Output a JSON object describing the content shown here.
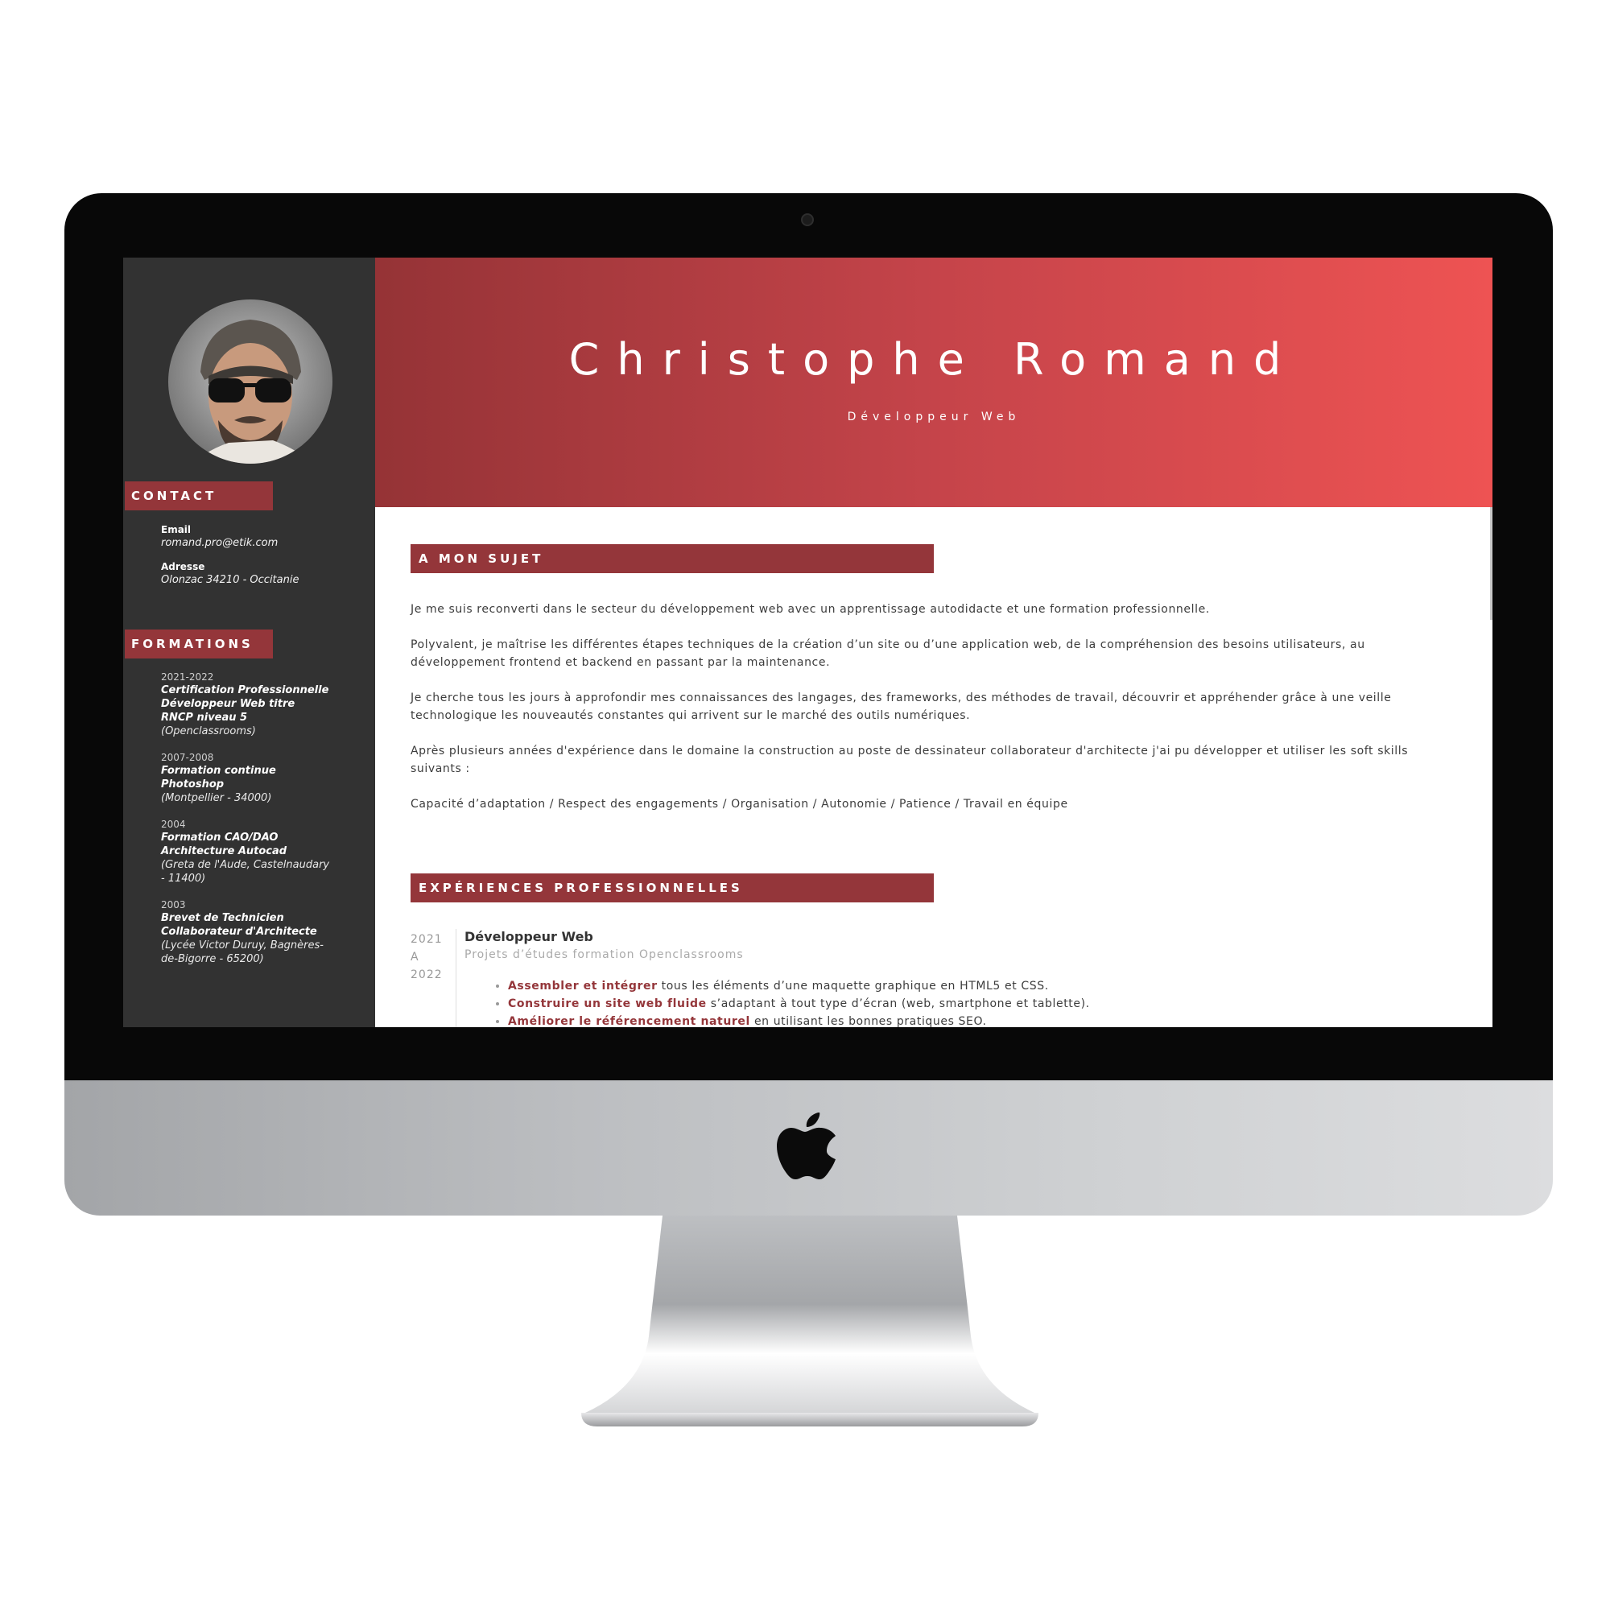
{
  "header": {
    "name": "Christophe Romand",
    "subtitle": "Développeur Web"
  },
  "sidebar": {
    "contact_heading": "CONTACT",
    "email_label": "Email",
    "email_value": "romand.pro@etik.com",
    "address_label": "Adresse",
    "address_value": "Olonzac 34210 - Occitanie",
    "formations_heading": "FORMATIONS",
    "formations": [
      {
        "year": "2021-2022",
        "title": "Certification Professionnelle Développeur Web titre RNCP niveau 5",
        "place": "(Openclassrooms)"
      },
      {
        "year": "2007-2008",
        "title": "Formation continue Photoshop",
        "place": "(Montpellier - 34000)"
      },
      {
        "year": "2004",
        "title": "Formation CAO/DAO Architecture Autocad",
        "place": "(Greta de l'Aude, Castelnaudary - 11400)"
      },
      {
        "year": "2003",
        "title": "Brevet de Technicien Collaborateur d'Architecte",
        "place": "(Lycée Victor Duruy, Bagnères-de-Bigorre - 65200)"
      }
    ]
  },
  "about": {
    "heading": "A MON SUJET",
    "paragraphs": [
      "Je me suis reconverti dans le secteur du développement web avec un apprentissage autodidacte et une formation professionnelle.",
      "Polyvalent, je maîtrise les différentes étapes techniques de la création d’un site ou d’une application web, de la compréhension des besoins utilisateurs, au développement frontend et backend en passant par la maintenance.",
      "Je cherche tous les jours à approfondir mes connaissances des langages, des frameworks, des méthodes de travail, découvrir et appréhender grâce à une veille technologique les nouveautés constantes qui arrivent sur le marché des outils numériques.",
      "Après plusieurs années d'expérience dans le domaine la construction au poste de dessinateur collaborateur d'architecte j'ai pu développer et utiliser les soft skills suivants :",
      "Capacité d’adaptation / Respect des engagements / Organisation / Autonomie / Patience / Travail en équipe"
    ]
  },
  "experiences": {
    "heading": "EXPÉRIENCES PROFESSIONNELLES",
    "items": [
      {
        "year_from": "2021",
        "year_sep": "A",
        "year_to": "2022",
        "title": "Développeur Web",
        "subtitle": "Projets d’études formation Openclassrooms",
        "bullets": [
          {
            "strong": "Assembler et intégrer",
            "rest": " tous les éléments d’une maquette graphique en HTML5 et CSS."
          },
          {
            "strong": "Construire un site web fluide",
            "rest": " s’adaptant à tout type d’écran (web, smartphone et tablette)."
          },
          {
            "strong": "Améliorer le référencement naturel",
            "rest": " en utilisant les bonnes pratiques SEO."
          }
        ]
      }
    ]
  },
  "device": {
    "brand_icon": "apple-logo-icon",
    "accent_color": "#94363a",
    "sidebar_color": "#323232"
  }
}
